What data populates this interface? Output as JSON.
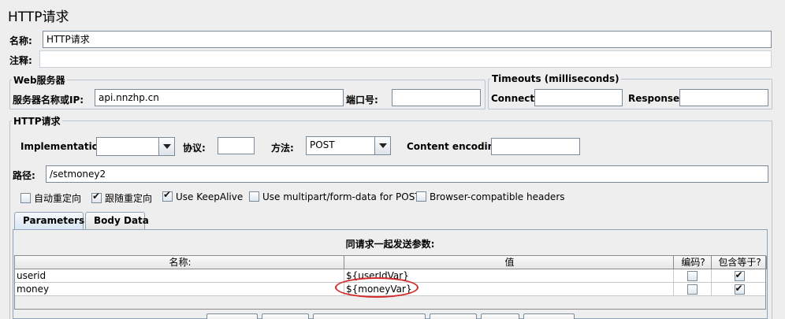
{
  "page_title": "HTTP请求",
  "name": {
    "label": "名称:",
    "value": "HTTP请求"
  },
  "comment": {
    "label": "注释:",
    "value": ""
  },
  "web_server": {
    "legend": "Web服务器",
    "server_label": "服务器名称或IP:",
    "server_value": "api.nnzhp.cn",
    "port_label": "端口号:",
    "port_value": ""
  },
  "timeouts": {
    "legend": "Timeouts (milliseconds)",
    "connect_label": "Connect:",
    "connect_value": "",
    "response_label": "Response:",
    "response_value": ""
  },
  "http_request": {
    "legend": "HTTP请求",
    "implementation_label": "Implementation:",
    "implementation_value": "",
    "protocol_label": "协议:",
    "protocol_value": "",
    "method_label": "方法:",
    "method_value": "POST",
    "encoding_label": "Content encoding:",
    "encoding_value": "",
    "path_label": "路径:",
    "path_value": "/setmoney2"
  },
  "options": [
    {
      "label": "自动重定向",
      "checked": false
    },
    {
      "label": "跟随重定向",
      "checked": true
    },
    {
      "label": "Use KeepAlive",
      "checked": true
    },
    {
      "label": "Use multipart/form-data for POST",
      "checked": false
    },
    {
      "label": "Browser-compatible headers",
      "checked": false
    }
  ],
  "tabs": [
    {
      "label": "Parameters",
      "active": true
    },
    {
      "label": "Body Data",
      "active": false
    }
  ],
  "params_table": {
    "title": "同请求一起发送参数:",
    "headers": [
      "名称:",
      "值",
      "编码?",
      "包含等于?"
    ],
    "rows": [
      {
        "name": "userid",
        "value": "${userIdVar}",
        "encode": false,
        "include_equals": true
      },
      {
        "name": "money",
        "value": "${moneyVar}",
        "encode": false,
        "include_equals": true
      }
    ]
  },
  "colors": {
    "highlight": "#d42a2a",
    "border": "#7a8a99"
  }
}
